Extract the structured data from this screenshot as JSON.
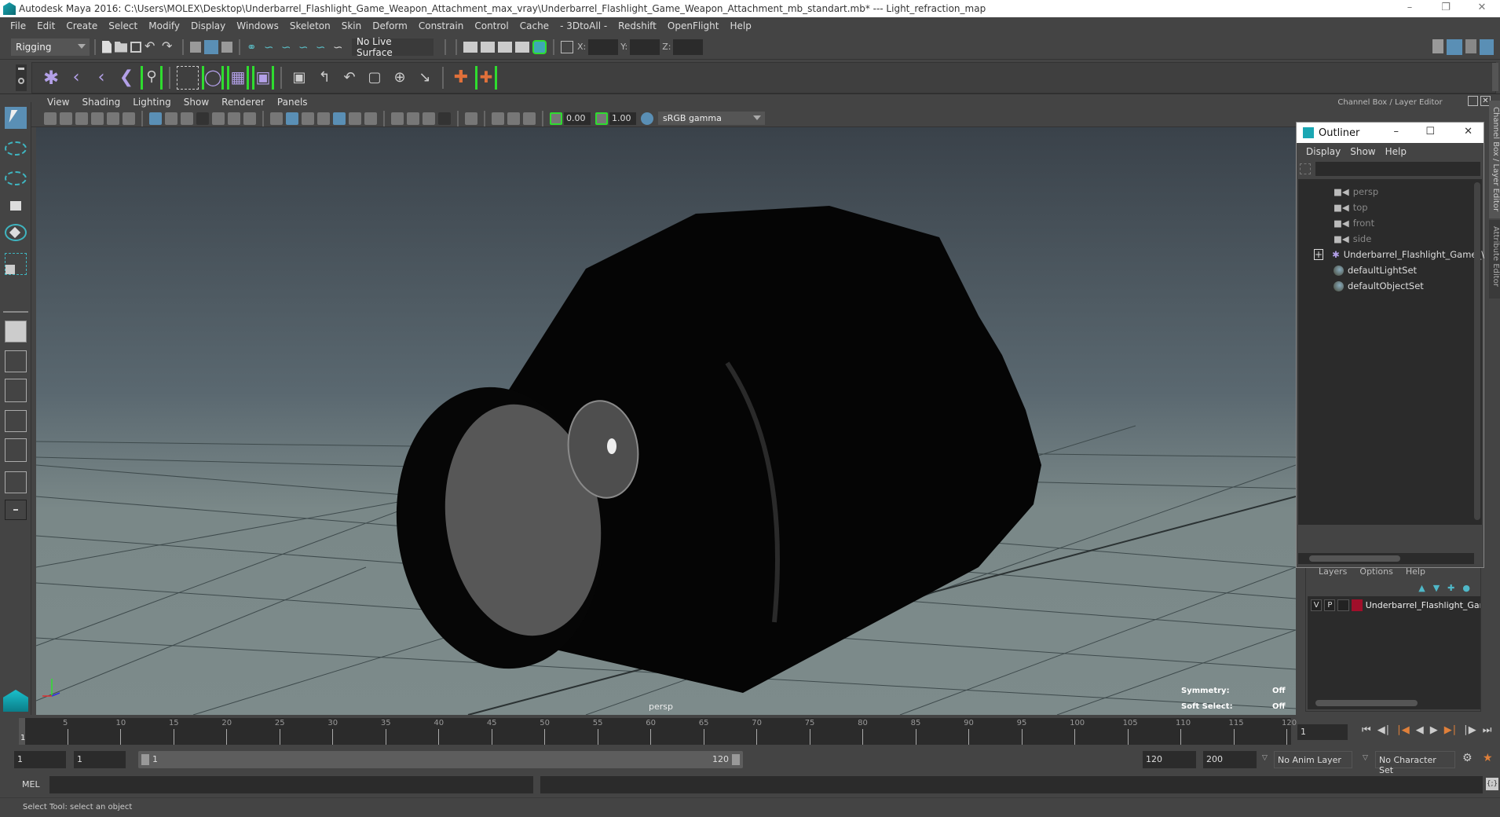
{
  "window": {
    "title": "Autodesk Maya 2016: C:\\Users\\MOLEX\\Desktop\\Underbarrel_Flashlight_Game_Weapon_Attachment_max_vray\\Underbarrel_Flashlight_Game_Weapon_Attachment_mb_standart.mb*  ---  Light_refraction_map",
    "controls": [
      "minimize",
      "restore",
      "close"
    ]
  },
  "menubar": [
    "File",
    "Edit",
    "Create",
    "Select",
    "Modify",
    "Display",
    "Windows",
    "Skeleton",
    "Skin",
    "Deform",
    "Constrain",
    "Control",
    "Cache",
    "- 3DtoAll -",
    "Redshift",
    "OpenFlight",
    "Help"
  ],
  "statusline": {
    "mode": "Rigging",
    "live_surface": "No Live Surface",
    "x_label": "X:",
    "y_label": "Y:",
    "z_label": "Z:",
    "x_value": "",
    "y_value": "",
    "z_value": ""
  },
  "shelf": {
    "icons": [
      "joint-tool-icon",
      "ik-handle-icon",
      "ik-spline-icon",
      "insert-joint-icon",
      "skeleton-bind-icon",
      "paint-weights-icon",
      "smooth-bind-icon",
      "lattice-icon",
      "cluster-icon",
      "parent-constraint-icon",
      "point-constraint-icon",
      "orient-constraint-icon",
      "scale-constraint-icon",
      "aim-constraint-icon",
      "pole-vector-icon",
      "locator-icon",
      "hik-icon"
    ]
  },
  "panel": {
    "menus": [
      "View",
      "Shading",
      "Lighting",
      "Show",
      "Renderer",
      "Panels"
    ],
    "exposure": "0.00",
    "gamma": "1.00",
    "color_space": "sRGB gamma",
    "camera_label": "persp",
    "symmetry_label": "Symmetry:",
    "symmetry_value": "Off",
    "soft_select_label": "Soft Select:",
    "soft_select_value": "Off"
  },
  "channel_box": {
    "title": "Channel Box / Layer Editor",
    "side_tabs": [
      "Channel Box / Layer Editor",
      "Attribute Editor"
    ]
  },
  "outliner": {
    "title": "Outliner",
    "menus": [
      "Display",
      "Show",
      "Help"
    ],
    "filter_value": "",
    "items": [
      {
        "label": "persp",
        "icon": "camera-icon",
        "dim": true
      },
      {
        "label": "top",
        "icon": "camera-icon",
        "dim": true
      },
      {
        "label": "front",
        "icon": "camera-icon",
        "dim": true
      },
      {
        "label": "side",
        "icon": "camera-icon",
        "dim": true
      },
      {
        "label": "Underbarrel_Flashlight_Game_\\",
        "icon": "transform-icon",
        "dim": false,
        "expandable": true
      },
      {
        "label": "defaultLightSet",
        "icon": "set-icon",
        "dim": false
      },
      {
        "label": "defaultObjectSet",
        "icon": "set-icon",
        "dim": false
      }
    ]
  },
  "layers": {
    "menus": [
      "Layers",
      "Options",
      "Help"
    ],
    "rows": [
      {
        "v": "V",
        "p": "P",
        "color": "#a00f2a",
        "name": "Underbarrel_Flashlight_Gam"
      }
    ]
  },
  "timeline": {
    "ticks": [
      "5",
      "10",
      "15",
      "20",
      "25",
      "30",
      "35",
      "40",
      "45",
      "50",
      "55",
      "60",
      "65",
      "70",
      "75",
      "80",
      "85",
      "90",
      "95",
      "100",
      "105",
      "110",
      "115",
      "120"
    ],
    "current_marker": "1",
    "current_frame": "1"
  },
  "range": {
    "start": "1",
    "inner_start": "1",
    "slider_start": "1",
    "slider_end": "120",
    "end": "120",
    "outer_end": "200",
    "anim_layer": "No Anim Layer",
    "character_set": "No Character Set"
  },
  "command": {
    "language": "MEL",
    "input": "",
    "result": ""
  },
  "help_line": "Select Tool: select an object",
  "colors": {
    "accent": "#5a8fb5",
    "highlight_green": "#2fdc2f",
    "layer_color": "#a00f2a",
    "viewport_top": "#3a424a",
    "viewport_bottom": "#7d8b8b"
  }
}
